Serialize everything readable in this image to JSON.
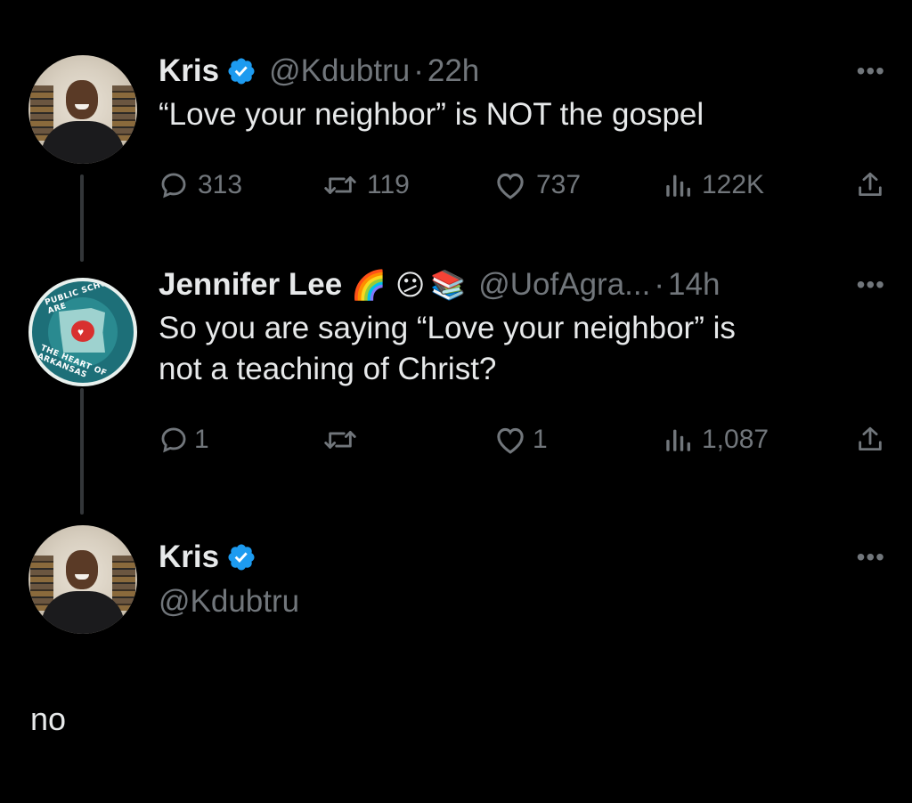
{
  "tweets": [
    {
      "name": "Kris",
      "verified": true,
      "handle": "@Kdubtru",
      "dot": "·",
      "time": "22h",
      "text": "“Love your neighbor” is NOT the gospel",
      "replies": "313",
      "retweets": "119",
      "likes": "737",
      "views": "122K",
      "more_icon": "more-icon"
    },
    {
      "name": "Jennifer Lee",
      "emojis": [
        "🌈",
        "😕",
        "📚"
      ],
      "handle": "@UofAgra...",
      "dot": "·",
      "time": "14h",
      "text_line1": "So you are saying “Love your neighbor” is",
      "text_line2": "not a teaching of Christ?",
      "replies": "1",
      "retweets": "",
      "likes": "1",
      "views": "1,087",
      "avatar_text_top": "PUBLIC SCHOOLS ARE",
      "avatar_text_bottom": "THE HEART OF ARKANSAS"
    },
    {
      "name": "Kris",
      "verified": true,
      "handle": "@Kdubtru",
      "text": "no"
    }
  ],
  "colors": {
    "background": "#000000",
    "text": "#e7e9ea",
    "muted": "#71767b",
    "verified": "#1d9bf0",
    "thread_line": "#333639"
  }
}
